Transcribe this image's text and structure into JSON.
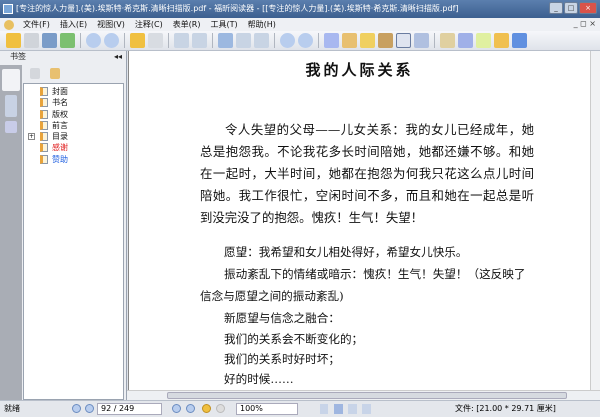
{
  "window": {
    "title": "[专注的惊人力量].(美).埃斯特·希克斯.清晰扫描版.pdf - 福昕阅读器 - [[专注的惊人力量].(美).埃斯特·希克斯.清晰扫描版.pdf]"
  },
  "menu": [
    "文件(F)",
    "插入(E)",
    "视图(V)",
    "注释(C)",
    "表单(R)",
    "工具(T)",
    "帮助(H)"
  ],
  "sidebar": {
    "title": "书签",
    "bookmarks": [
      {
        "label": "封面",
        "color": "#111111"
      },
      {
        "label": "书名",
        "color": "#111111"
      },
      {
        "label": "版权",
        "color": "#111111"
      },
      {
        "label": "前言",
        "color": "#111111"
      },
      {
        "label": "目录",
        "color": "#111111",
        "expandable": true
      },
      {
        "label": "感谢",
        "color": "#e02020"
      },
      {
        "label": "赞助",
        "color": "#2060e0"
      }
    ]
  },
  "document": {
    "title": "我的人际关系",
    "paragraph": "令人失望的父母——儿女关系：我的女儿已经成年，她总是抱怨我。不论我花多长时间陪她，她都还嫌不够。和她在一起时，大半时间，她都在抱怨为何我只花这么点儿时间陪她。我工作很忙，空闲时间不多，而且和她在一起总是听到没完没了的抱怨。愧疚！生气！失望！",
    "lines": [
      "愿望：我希望和女儿相处得好，希望女儿快乐。",
      "振动紊乱下的情绪或暗示：愧疚！生气！失望！（这反映了",
      "信念与愿望之间的振动紊乱)",
      "新愿望与信念之融合：",
      "我们的关系会不断变化的；",
      "我们的关系时好时坏；",
      "好的时候……"
    ]
  },
  "status": {
    "ready": "就绪",
    "page": "92 / 249",
    "zoom": "100%",
    "file_size": "文件: [21.00 * 29.71 厘米]"
  }
}
